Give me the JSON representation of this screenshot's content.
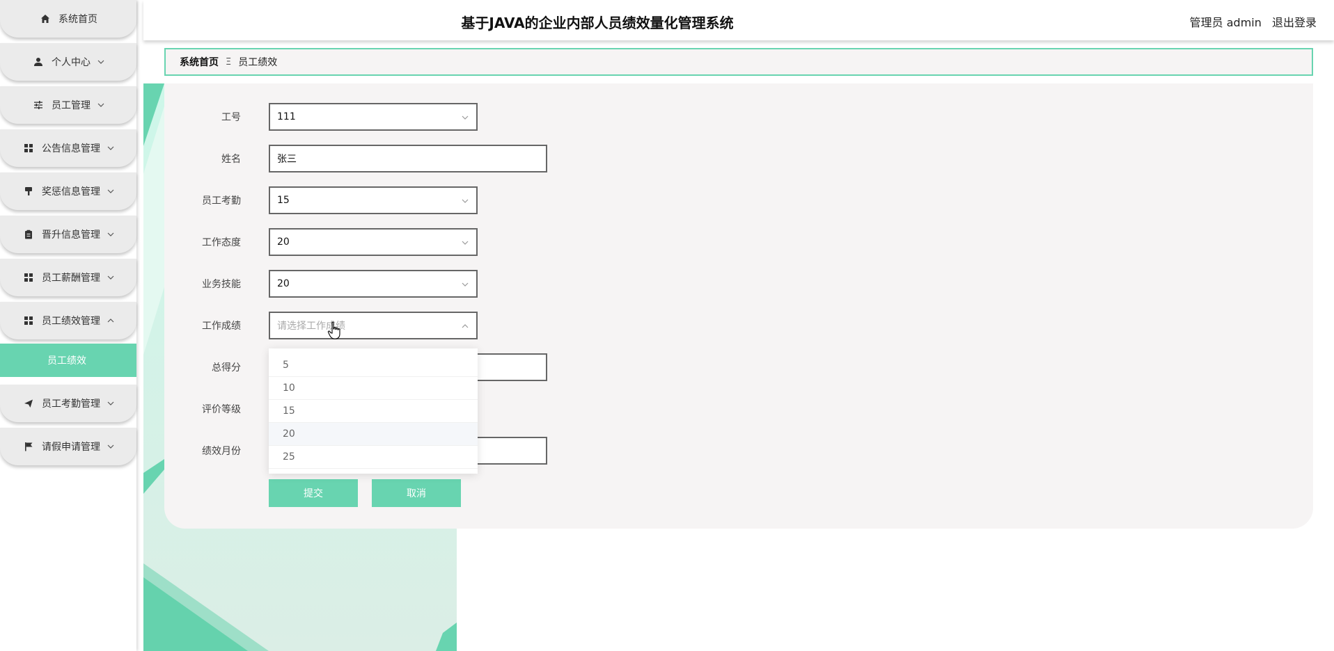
{
  "app": {
    "title": "基于JAVA的企业内部人员绩效量化管理系统",
    "user_label": "管理员 admin",
    "logout_label": "退出登录",
    "accent_color": "#68d4b0"
  },
  "sidebar": {
    "items": [
      {
        "label": "系统首页",
        "icon": "home-icon",
        "has_arrow": false
      },
      {
        "label": "个人中心",
        "icon": "person-icon",
        "has_arrow": true
      },
      {
        "label": "员工管理",
        "icon": "sliders-icon",
        "has_arrow": true
      },
      {
        "label": "公告信息管理",
        "icon": "grid-icon",
        "has_arrow": true
      },
      {
        "label": "奖惩信息管理",
        "icon": "brush-icon",
        "has_arrow": true
      },
      {
        "label": "晋升信息管理",
        "icon": "clipboard-icon",
        "has_arrow": true
      },
      {
        "label": "员工薪酬管理",
        "icon": "grid-icon",
        "has_arrow": true
      },
      {
        "label": "员工绩效管理",
        "icon": "grid-icon",
        "has_arrow": true,
        "expanded": true
      },
      {
        "label": "员工考勤管理",
        "icon": "send-icon",
        "has_arrow": true
      },
      {
        "label": "请假申请管理",
        "icon": "flag-icon",
        "has_arrow": true
      }
    ],
    "active_subitem": "员工绩效"
  },
  "breadcrumb": {
    "home": "系统首页",
    "separator": "Ξ",
    "current": "员工绩效"
  },
  "form": {
    "fields": [
      {
        "label": "工号",
        "value": "111",
        "type": "select"
      },
      {
        "label": "姓名",
        "value": "张三",
        "type": "text"
      },
      {
        "label": "员工考勤",
        "value": "15",
        "type": "select"
      },
      {
        "label": "工作态度",
        "value": "20",
        "type": "select"
      },
      {
        "label": "业务技能",
        "value": "20",
        "type": "select"
      },
      {
        "label": "工作成绩",
        "value": "",
        "placeholder": "请选择工作成绩",
        "type": "select",
        "open": true
      },
      {
        "label": "总得分",
        "value": "",
        "type": "text"
      },
      {
        "label": "评价等级",
        "value": "",
        "type": "select"
      },
      {
        "label": "绩效月份",
        "value": "",
        "type": "text"
      }
    ],
    "submit_label": "提交",
    "cancel_label": "取消"
  },
  "dropdown": {
    "options": [
      "5",
      "10",
      "15",
      "20",
      "25"
    ],
    "hover_value": "20"
  }
}
